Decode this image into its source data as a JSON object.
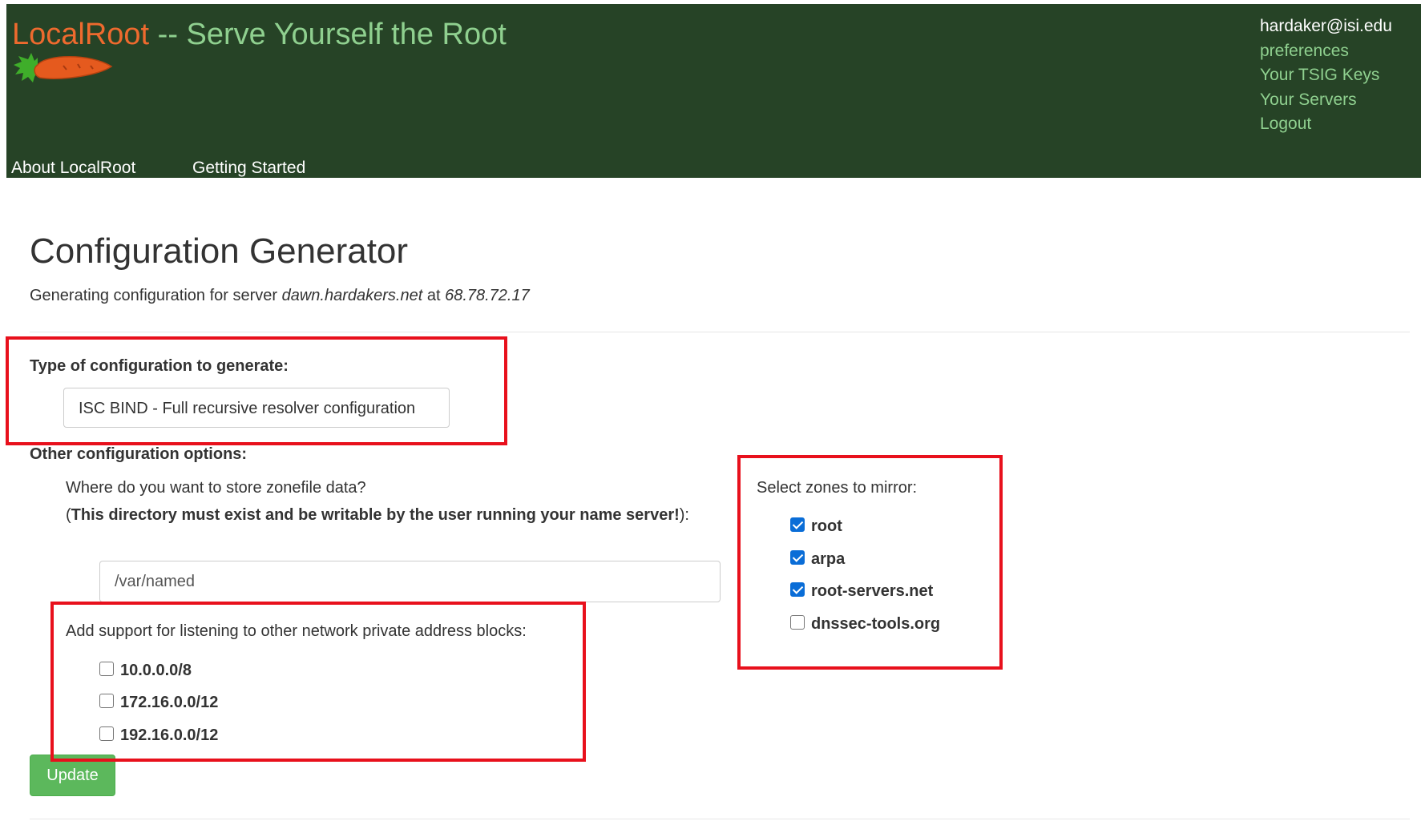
{
  "header": {
    "brand_name": "LocalRoot",
    "brand_rest": " -- Serve Yourself the Root",
    "user_email": "hardaker@isi.edu",
    "links": [
      "preferences",
      "Your TSIG Keys",
      "Your Servers",
      "Logout"
    ],
    "nav": [
      "About LocalRoot",
      "Getting Started"
    ]
  },
  "main": {
    "title": "Configuration Generator",
    "subtitle_prefix": "Generating configuration for server ",
    "server_name": "dawn.hardakers.net",
    "subtitle_at": " at ",
    "server_ip": "68.78.72.17",
    "config_type_label": "Type of configuration to generate:",
    "config_type_value": "ISC BIND - Full recursive resolver configuration",
    "other_options_label": "Other configuration options:",
    "zone_dir_question": "Where do you want to store zonefile data?",
    "zone_dir_note_open": "(",
    "zone_dir_note_bold": "This directory must exist and be writable by the user running your name server!",
    "zone_dir_note_close": "):",
    "zone_dir_value": "/var/named",
    "private_blocks_label": "Add support for listening to other network private address blocks:",
    "private_blocks": [
      {
        "label": "10.0.0.0/8",
        "checked": false
      },
      {
        "label": "172.16.0.0/12",
        "checked": false
      },
      {
        "label": "192.16.0.0/12",
        "checked": false
      }
    ],
    "zones_label": "Select zones to mirror:",
    "zones": [
      {
        "label": "root",
        "checked": true
      },
      {
        "label": "arpa",
        "checked": true
      },
      {
        "label": "root-servers.net",
        "checked": true
      },
      {
        "label": "dnssec-tools.org",
        "checked": false
      }
    ],
    "update_label": "Update"
  },
  "colors": {
    "header_bg": "#264326",
    "brand_orange": "#ee6a2e",
    "brand_green": "#8fd08f",
    "highlight_red": "#e8101c",
    "update_green": "#5cb85c"
  }
}
